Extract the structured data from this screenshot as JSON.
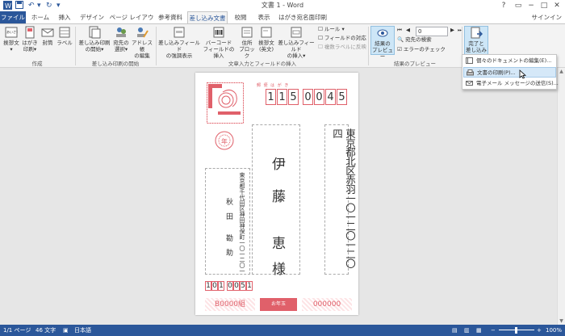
{
  "window": {
    "title": "文書 1 - Word",
    "help": "?",
    "minimize": "−",
    "restore": "□",
    "close": "✕"
  },
  "tabs": [
    {
      "label": "ファイル"
    },
    {
      "label": "ホーム"
    },
    {
      "label": "挿入"
    },
    {
      "label": "デザイン"
    },
    {
      "label": "ページ レイアウト"
    },
    {
      "label": "参考資料"
    },
    {
      "label": "差し込み文書"
    },
    {
      "label": "校閲"
    },
    {
      "label": "表示"
    },
    {
      "label": "はがき宛名面印刷"
    }
  ],
  "signin": "サインイン",
  "ribbon": {
    "create": {
      "group_label": "作成",
      "greeting": [
        "挨拶文",
        "▾"
      ],
      "postcard": [
        "はがき",
        "印刷▾"
      ],
      "envelope": "封筒",
      "label": "ラベル"
    },
    "start": {
      "group_label": "差し込み印刷の開始",
      "start_merge": [
        "差し込み印刷",
        "の開始▾"
      ],
      "select_recipients": [
        "宛先の",
        "選択▾"
      ],
      "edit_list": [
        "アドレス帳",
        "の編集"
      ]
    },
    "fields": {
      "group_label": "文章入力とフィールドの挿入",
      "highlight": [
        "差し込みフィールド",
        "の強調表示"
      ],
      "barcode": [
        "バーコード",
        "フィールドの挿入"
      ],
      "address_block": [
        "住所",
        "ブロック"
      ],
      "greeting_line": [
        "挨拶文",
        "(英文)"
      ],
      "insert_field": [
        "差し込みフィールド",
        "の挿入▾"
      ],
      "rules": "ルール ▾",
      "match_fields": "フィールドの対応",
      "update_labels": "複数ラベルに反映"
    },
    "preview": {
      "group_label": "結果のプレビュー",
      "preview_results": [
        "結果の",
        "プレビュー"
      ],
      "record": "0",
      "find_recipient": "宛先の検索",
      "check_errors": "エラーのチェック"
    },
    "finish": {
      "finish_merge": [
        "完了と",
        "差し込み▾"
      ]
    }
  },
  "dropdown": [
    "個々のドキュメントの編集(E)...",
    "文書の印刷(P)...",
    "電子メール メッセージの送信(S)..."
  ],
  "postcard": {
    "stamp_label": "郵 便 は が き",
    "postal_code": [
      "1",
      "1",
      "5",
      "0",
      "0",
      "4",
      "5"
    ],
    "recipient_address": "東京都北区赤羽一〇一二〇一二〇四",
    "recipient_name_1": "伊",
    "recipient_name_2": "藤",
    "recipient_name_3": "恵",
    "recipient_honorific": "様",
    "sender_address": "東京都千代田区神田神保町一〇一二〇一",
    "sender_name": "秋　田　　勘　助",
    "sender_postal": [
      "1",
      "0",
      "1",
      "0",
      "0",
      "5",
      "1"
    ],
    "lottery_left": "B0000組",
    "lottery_right": "000000",
    "lottery_badge": "お年玉"
  },
  "status": {
    "page": "1/1 ページ",
    "words": "46 文字",
    "language": "日本語",
    "zoom": "100%"
  },
  "colors": {
    "accent": "#2b579a",
    "stamp_red": "#e0606a"
  }
}
